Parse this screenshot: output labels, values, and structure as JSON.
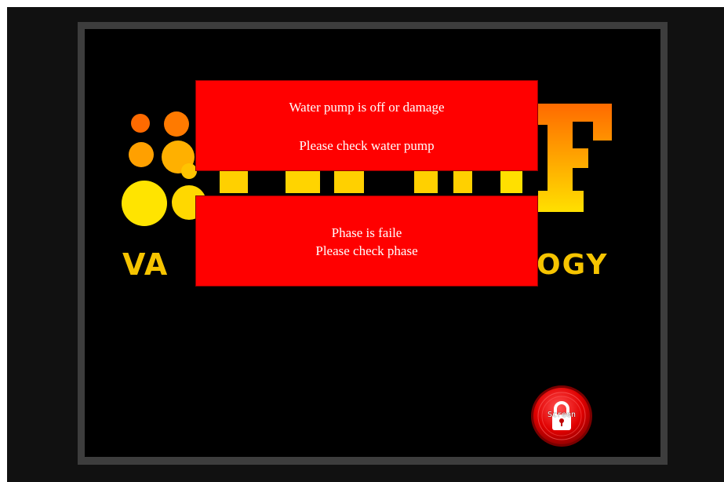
{
  "alarms": {
    "pump": {
      "line1": "Water pump is off or  damage",
      "line2": "Please check water pump"
    },
    "phase": {
      "line1": "Phase is faile",
      "line2": "Please check phase"
    }
  },
  "logo": {
    "left_fragment": "VA",
    "right_fragment": "OGY"
  },
  "lock_button": {
    "label": "Screen",
    "icon": "padlock-icon"
  },
  "colors": {
    "alarm_background": "#ff0000",
    "alarm_text": "#ffffff",
    "screen_background": "#000000",
    "frame": "#3d3d3d",
    "logo_orange": "#ff6a00",
    "logo_yellow": "#ffe600"
  }
}
